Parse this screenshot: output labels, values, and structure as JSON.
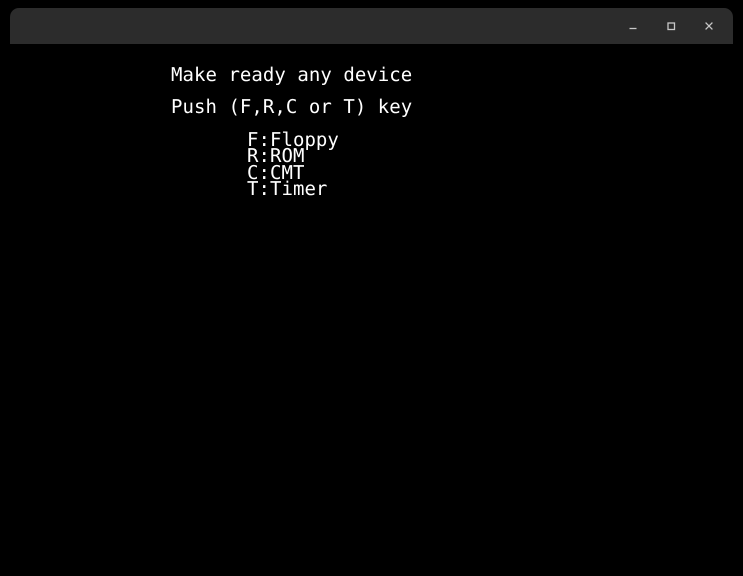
{
  "window": {
    "title": "",
    "titlebar_color": "#2c2c2c",
    "screen_color": "#000000",
    "text_color": "#ffffff",
    "controls": {
      "minimize_label": "–",
      "maximize_label": "□",
      "close_label": "×",
      "minimize_name": "minimize",
      "maximize_name": "maximize",
      "close_name": "close"
    }
  },
  "screen": {
    "prompt_line_1": "Make ready any device",
    "prompt_line_2": "Push (F,R,C or T) key",
    "devices": [
      {
        "key": "F",
        "label": "F:Floppy",
        "name": "Floppy"
      },
      {
        "key": "R",
        "label": "R:ROM",
        "name": "ROM"
      },
      {
        "key": "C",
        "label": "C:CMT",
        "name": "CMT"
      },
      {
        "key": "T",
        "label": "T:Timer",
        "name": "Timer"
      }
    ]
  }
}
